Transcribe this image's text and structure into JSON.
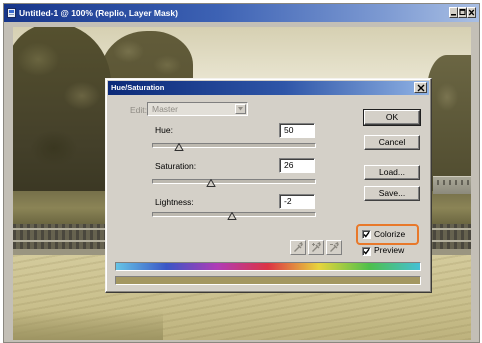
{
  "window": {
    "title": "Untitled-1 @ 100% (Replio, Layer Mask)"
  },
  "dialog": {
    "title": "Hue/Saturation",
    "edit": {
      "label": "Edit:",
      "value": "Master",
      "enabled": false
    },
    "sliders": [
      {
        "label": "Hue:",
        "value": "50",
        "level": 0.16
      },
      {
        "label": "Saturation:",
        "value": "26",
        "level": 0.36
      },
      {
        "label": "Lightness:",
        "value": "-2",
        "level": 0.49
      }
    ],
    "buttons": {
      "ok": "OK",
      "cancel": "Cancel",
      "load": "Load...",
      "save": "Save..."
    },
    "colorize": {
      "label": "Colorize",
      "checked": true,
      "highlighted": true
    },
    "preview": {
      "label": "Preview",
      "checked": true
    },
    "spectrum_bar": {
      "colors": [
        "#66c4e6",
        "#3a56c6",
        "#b03cb6",
        "#dc3444",
        "#e8d43c",
        "#4ec04c",
        "#44c0d6"
      ]
    },
    "result_bar": {
      "color": "#a39762"
    }
  },
  "icons": [
    "document-icon",
    "minimize-icon",
    "maximize-icon",
    "close-icon",
    "chevron-down-icon",
    "eyedropper-icon",
    "eyedropper-plus-icon",
    "eyedropper-minus-icon",
    "check-icon"
  ],
  "colors": {
    "title_bar": "#16358a",
    "dialog_face": "#d4d0c8",
    "colorize_highlight": "#e8782a"
  }
}
